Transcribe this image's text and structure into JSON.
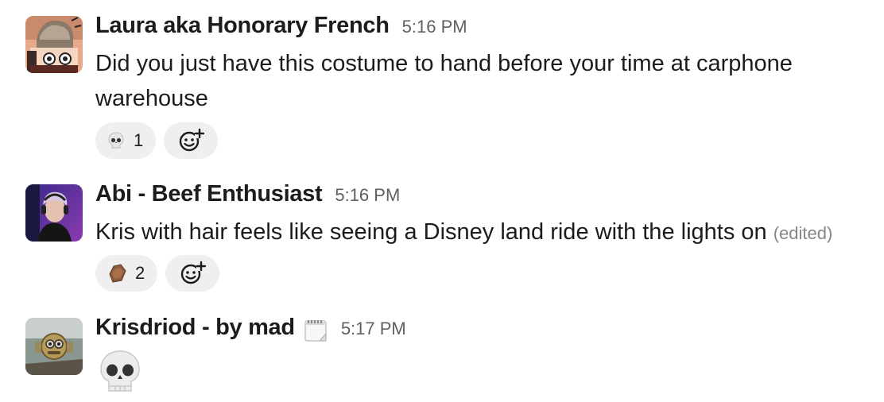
{
  "messages": [
    {
      "author": "Laura aka Honorary French",
      "time": "5:16 PM",
      "text": "Did you just have this costume to hand before your time at carphone warehouse",
      "avatar_icon": "cartoon-kid-icon",
      "reactions": [
        {
          "emoji": "skull-icon",
          "count": "1"
        }
      ]
    },
    {
      "author": "Abi - Beef Enthusiast",
      "time": "5:16 PM",
      "text": "Kris with hair feels like seeing a Disney land ride with the lights on",
      "edited": "(edited)",
      "avatar_icon": "photo-avatar-icon",
      "reactions": [
        {
          "emoji": "coffin-icon",
          "count": "2"
        }
      ]
    },
    {
      "author": "Krisdriod - by mad",
      "time": "5:17 PM",
      "status_emoji": "notepad-calendar-icon",
      "avatar_icon": "robot-avatar-icon",
      "big_emoji": "skull-icon"
    }
  ],
  "colors": {
    "text": "#1d1c1d",
    "timestamp": "#616061",
    "reaction_bg": "#f0efef"
  }
}
